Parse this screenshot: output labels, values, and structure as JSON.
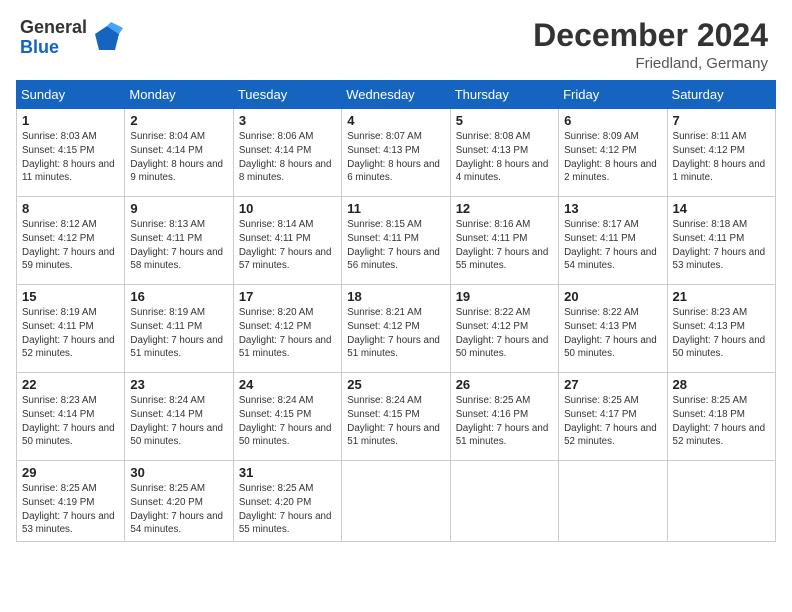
{
  "header": {
    "logo_general": "General",
    "logo_blue": "Blue",
    "month_title": "December 2024",
    "location": "Friedland, Germany"
  },
  "weekdays": [
    "Sunday",
    "Monday",
    "Tuesday",
    "Wednesday",
    "Thursday",
    "Friday",
    "Saturday"
  ],
  "weeks": [
    [
      {
        "day": "1",
        "sunrise": "8:03 AM",
        "sunset": "4:15 PM",
        "daylight": "8 hours and 11 minutes."
      },
      {
        "day": "2",
        "sunrise": "8:04 AM",
        "sunset": "4:14 PM",
        "daylight": "8 hours and 9 minutes."
      },
      {
        "day": "3",
        "sunrise": "8:06 AM",
        "sunset": "4:14 PM",
        "daylight": "8 hours and 8 minutes."
      },
      {
        "day": "4",
        "sunrise": "8:07 AM",
        "sunset": "4:13 PM",
        "daylight": "8 hours and 6 minutes."
      },
      {
        "day": "5",
        "sunrise": "8:08 AM",
        "sunset": "4:13 PM",
        "daylight": "8 hours and 4 minutes."
      },
      {
        "day": "6",
        "sunrise": "8:09 AM",
        "sunset": "4:12 PM",
        "daylight": "8 hours and 2 minutes."
      },
      {
        "day": "7",
        "sunrise": "8:11 AM",
        "sunset": "4:12 PM",
        "daylight": "8 hours and 1 minute."
      }
    ],
    [
      {
        "day": "8",
        "sunrise": "8:12 AM",
        "sunset": "4:12 PM",
        "daylight": "7 hours and 59 minutes."
      },
      {
        "day": "9",
        "sunrise": "8:13 AM",
        "sunset": "4:11 PM",
        "daylight": "7 hours and 58 minutes."
      },
      {
        "day": "10",
        "sunrise": "8:14 AM",
        "sunset": "4:11 PM",
        "daylight": "7 hours and 57 minutes."
      },
      {
        "day": "11",
        "sunrise": "8:15 AM",
        "sunset": "4:11 PM",
        "daylight": "7 hours and 56 minutes."
      },
      {
        "day": "12",
        "sunrise": "8:16 AM",
        "sunset": "4:11 PM",
        "daylight": "7 hours and 55 minutes."
      },
      {
        "day": "13",
        "sunrise": "8:17 AM",
        "sunset": "4:11 PM",
        "daylight": "7 hours and 54 minutes."
      },
      {
        "day": "14",
        "sunrise": "8:18 AM",
        "sunset": "4:11 PM",
        "daylight": "7 hours and 53 minutes."
      }
    ],
    [
      {
        "day": "15",
        "sunrise": "8:19 AM",
        "sunset": "4:11 PM",
        "daylight": "7 hours and 52 minutes."
      },
      {
        "day": "16",
        "sunrise": "8:19 AM",
        "sunset": "4:11 PM",
        "daylight": "7 hours and 51 minutes."
      },
      {
        "day": "17",
        "sunrise": "8:20 AM",
        "sunset": "4:12 PM",
        "daylight": "7 hours and 51 minutes."
      },
      {
        "day": "18",
        "sunrise": "8:21 AM",
        "sunset": "4:12 PM",
        "daylight": "7 hours and 51 minutes."
      },
      {
        "day": "19",
        "sunrise": "8:22 AM",
        "sunset": "4:12 PM",
        "daylight": "7 hours and 50 minutes."
      },
      {
        "day": "20",
        "sunrise": "8:22 AM",
        "sunset": "4:13 PM",
        "daylight": "7 hours and 50 minutes."
      },
      {
        "day": "21",
        "sunrise": "8:23 AM",
        "sunset": "4:13 PM",
        "daylight": "7 hours and 50 minutes."
      }
    ],
    [
      {
        "day": "22",
        "sunrise": "8:23 AM",
        "sunset": "4:14 PM",
        "daylight": "7 hours and 50 minutes."
      },
      {
        "day": "23",
        "sunrise": "8:24 AM",
        "sunset": "4:14 PM",
        "daylight": "7 hours and 50 minutes."
      },
      {
        "day": "24",
        "sunrise": "8:24 AM",
        "sunset": "4:15 PM",
        "daylight": "7 hours and 50 minutes."
      },
      {
        "day": "25",
        "sunrise": "8:24 AM",
        "sunset": "4:15 PM",
        "daylight": "7 hours and 51 minutes."
      },
      {
        "day": "26",
        "sunrise": "8:25 AM",
        "sunset": "4:16 PM",
        "daylight": "7 hours and 51 minutes."
      },
      {
        "day": "27",
        "sunrise": "8:25 AM",
        "sunset": "4:17 PM",
        "daylight": "7 hours and 52 minutes."
      },
      {
        "day": "28",
        "sunrise": "8:25 AM",
        "sunset": "4:18 PM",
        "daylight": "7 hours and 52 minutes."
      }
    ],
    [
      {
        "day": "29",
        "sunrise": "8:25 AM",
        "sunset": "4:19 PM",
        "daylight": "7 hours and 53 minutes."
      },
      {
        "day": "30",
        "sunrise": "8:25 AM",
        "sunset": "4:20 PM",
        "daylight": "7 hours and 54 minutes."
      },
      {
        "day": "31",
        "sunrise": "8:25 AM",
        "sunset": "4:20 PM",
        "daylight": "7 hours and 55 minutes."
      },
      null,
      null,
      null,
      null
    ]
  ]
}
